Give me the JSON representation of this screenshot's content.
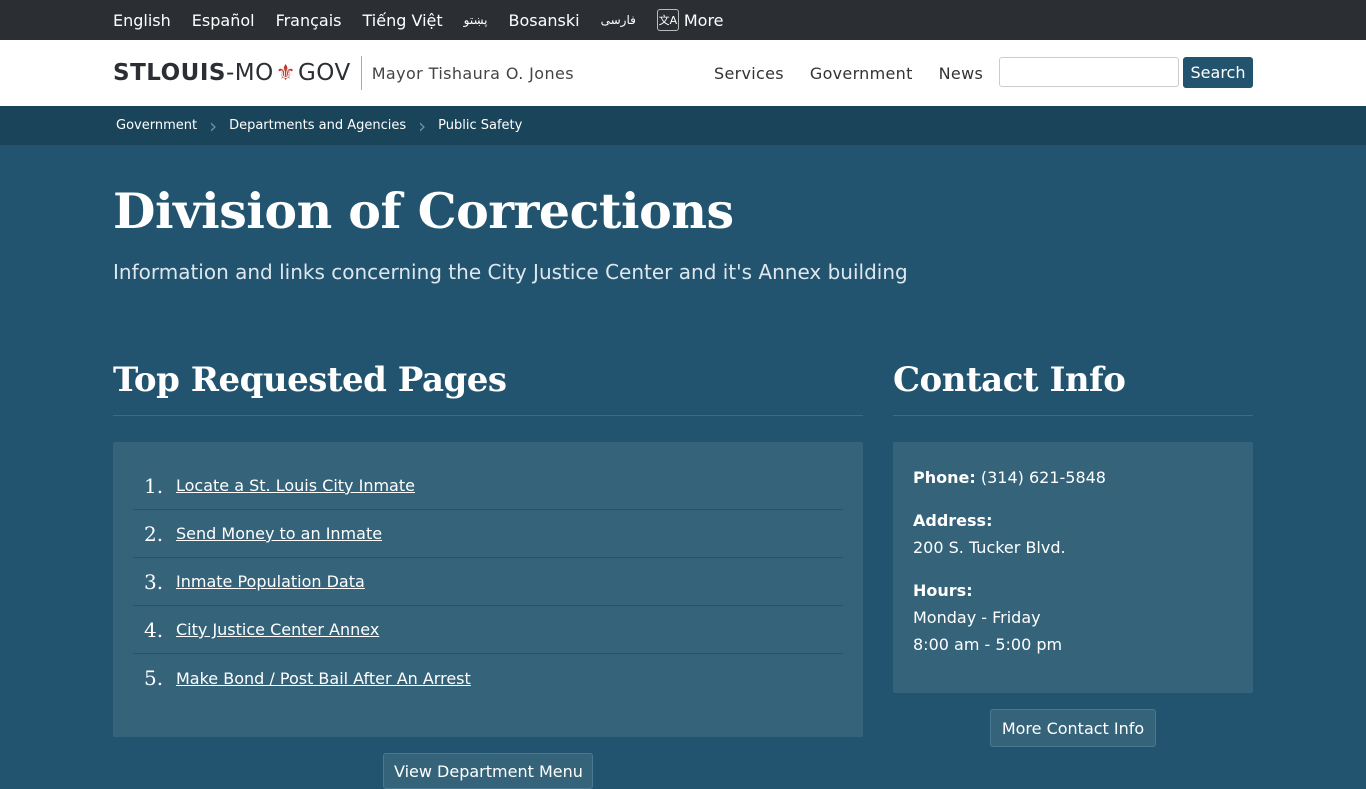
{
  "languages": {
    "english": "English",
    "spanish": "Español",
    "french": "Français",
    "vietnamese": "Tiếng Việt",
    "pashto": "پښتو",
    "bosnian": "Bosanski",
    "farsi": "فارسی",
    "more": "More"
  },
  "header": {
    "logo_stlouis": "STLOUIS",
    "logo_dash": "-MO",
    "logo_gov": "GOV",
    "mayor": "Mayor Tishaura O. Jones",
    "nav": [
      "Services",
      "Government",
      "News"
    ],
    "search_placeholder": "",
    "search_label": "Search"
  },
  "breadcrumb": [
    "Government",
    "Departments and Agencies",
    "Public Safety"
  ],
  "page": {
    "title": "Division of Corrections",
    "subtitle": "Information and links concerning the City Justice Center and it's Annex building"
  },
  "top_requested": {
    "heading": "Top Requested Pages",
    "items": [
      {
        "num": "1.",
        "label": "Locate a St. Louis City Inmate"
      },
      {
        "num": "2.",
        "label": "Send Money to an Inmate"
      },
      {
        "num": "3.",
        "label": "Inmate Population Data"
      },
      {
        "num": "4.",
        "label": "City Justice Center Annex"
      },
      {
        "num": "5.",
        "label": "Make Bond / Post Bail After An Arrest"
      }
    ],
    "view_more": "View Department Menu"
  },
  "contact": {
    "heading": "Contact Info",
    "phone_label": "Phone:",
    "phone": "(314) 621-5848",
    "address_label": "Address:",
    "address": "200 S. Tucker Blvd.",
    "hours_label": "Hours:",
    "hours_days": "Monday - Friday",
    "hours_time": "8:00 am - 5:00 pm",
    "more_button": "More Contact Info"
  }
}
